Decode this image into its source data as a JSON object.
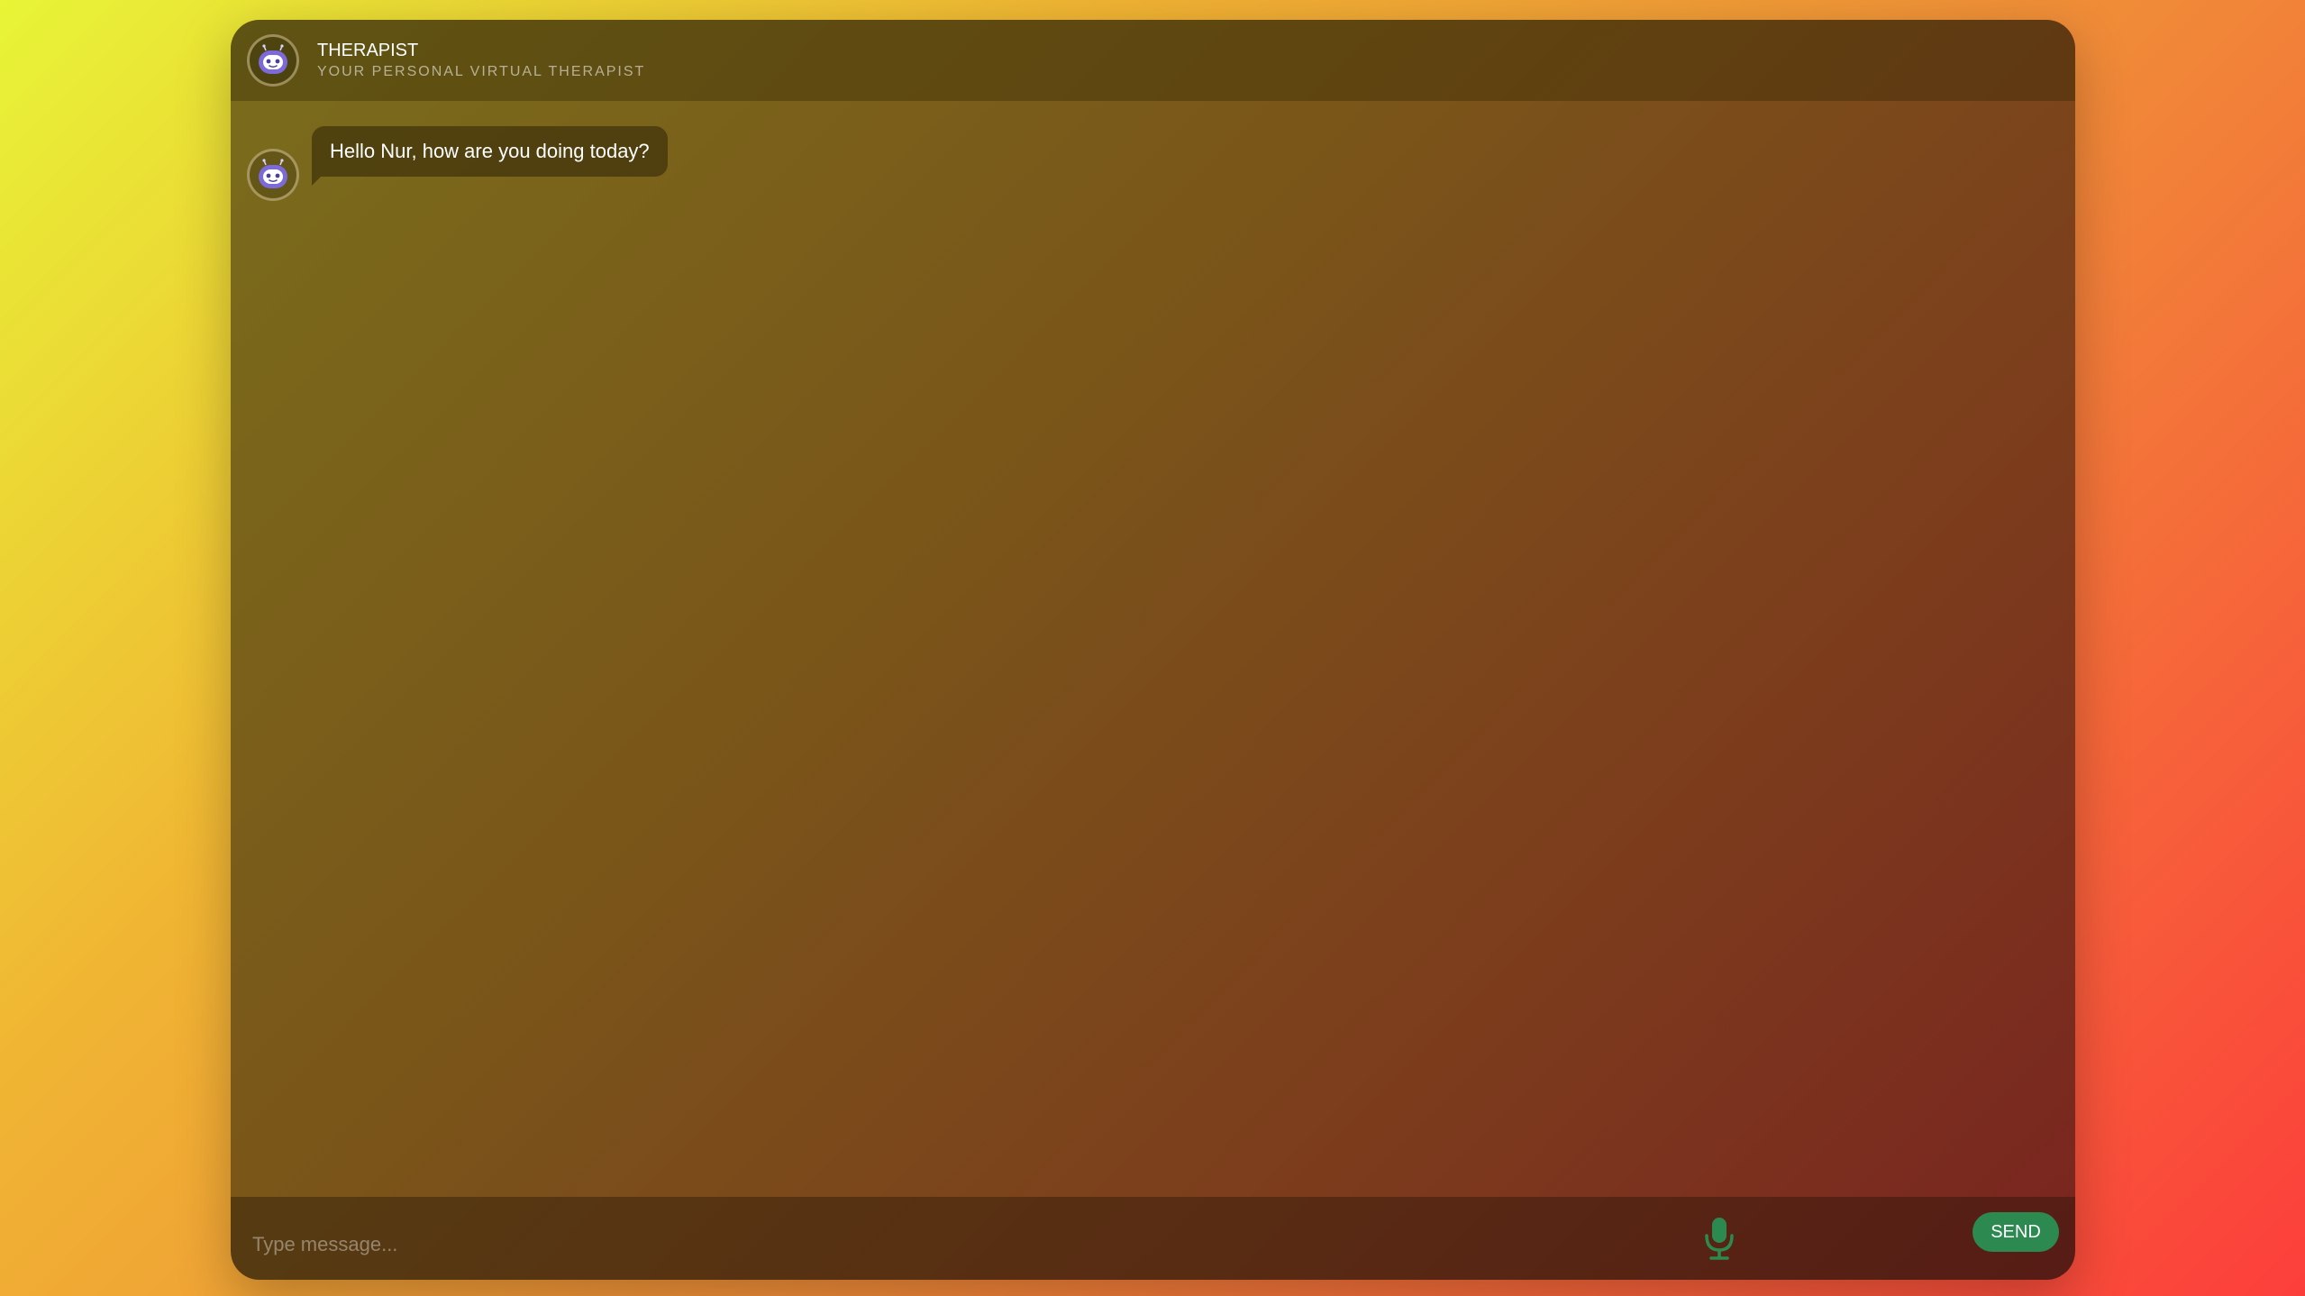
{
  "header": {
    "title": "THERAPIST",
    "subtitle": "YOUR PERSONAL VIRTUAL THERAPIST",
    "avatar_icon": "robot-face-icon"
  },
  "messages": [
    {
      "sender": "bot",
      "avatar_icon": "robot-face-icon",
      "text": "Hello Nur, how are you doing today?"
    }
  ],
  "composer": {
    "placeholder": "Type message...",
    "value": "",
    "mic_icon": "microphone-icon",
    "send_label": "SEND"
  },
  "colors": {
    "accent": "#2c8a50",
    "mic": "#2c8a50",
    "avatar_face": "#7b6ad8"
  }
}
